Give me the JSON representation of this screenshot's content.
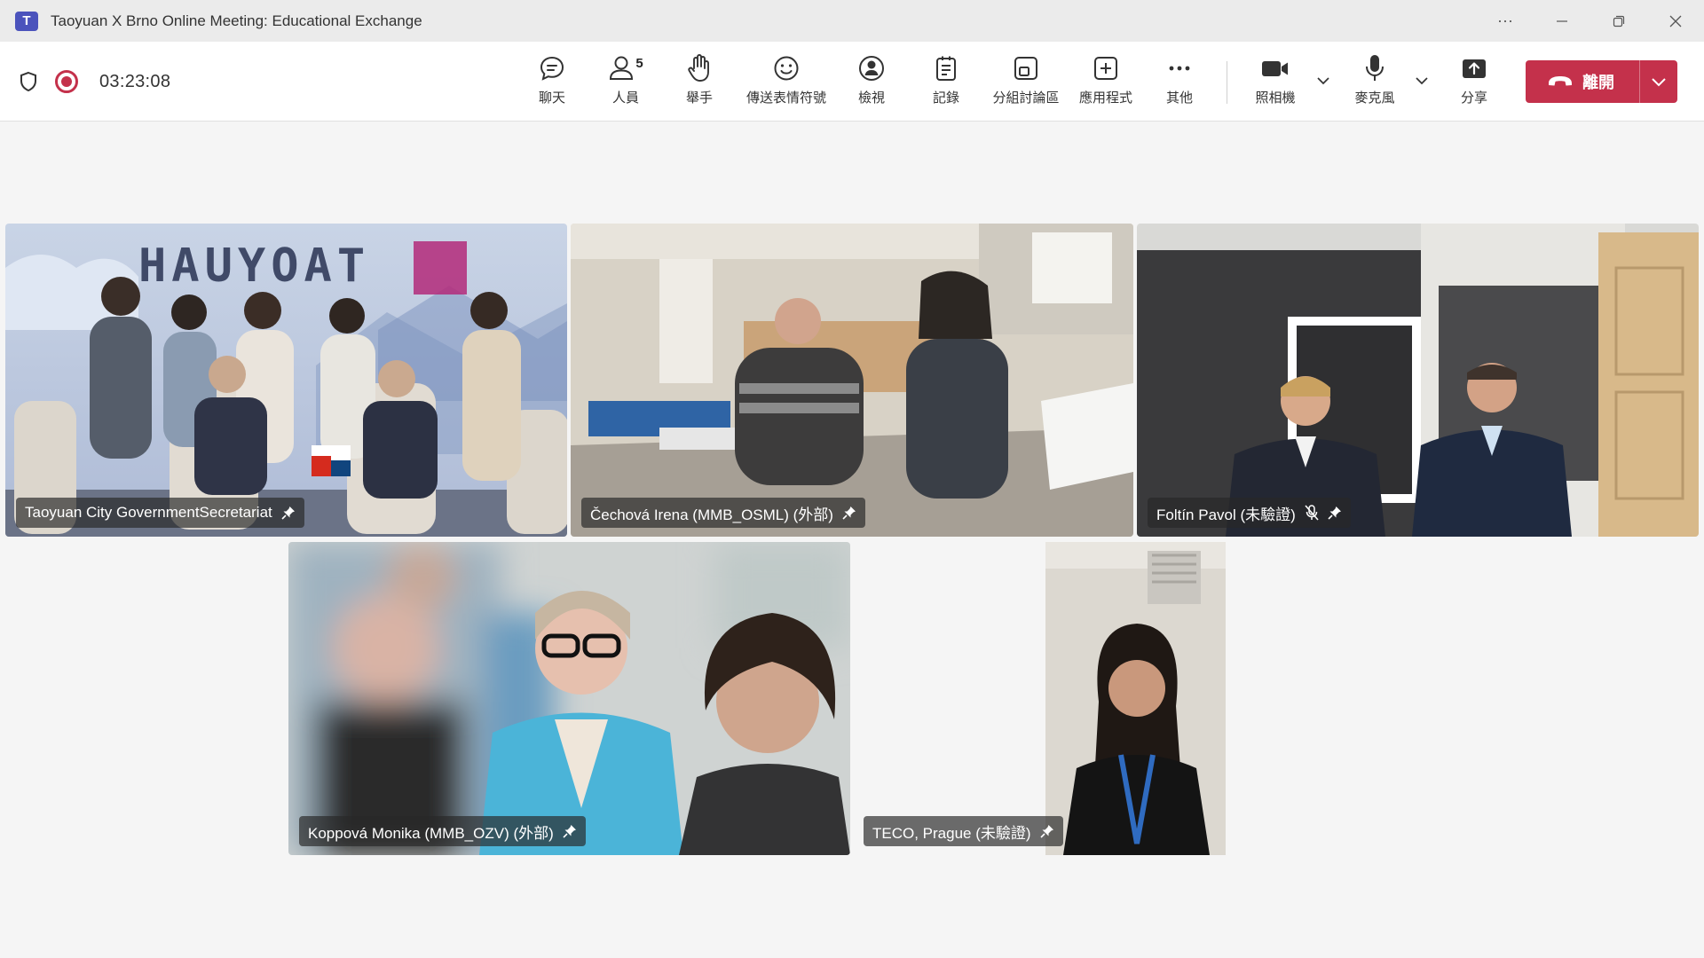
{
  "window": {
    "title": "Taoyuan X Brno Online Meeting: Educational Exchange",
    "app_icon": "teams-logo-icon",
    "more_symbol": "···"
  },
  "meeting_bar": {
    "timer": "03:23:08",
    "recording_color": "#c4314b",
    "buttons": {
      "chat": "聊天",
      "people": "人員",
      "people_count": "5",
      "raise_hand": "舉手",
      "reactions": "傳送表情符號",
      "view": "檢視",
      "notes": "記錄",
      "breakout": "分組討論區",
      "apps": "應用程式",
      "more": "其他",
      "camera": "照相機",
      "mic": "麥克風",
      "share": "分享"
    },
    "leave": {
      "label": "離開",
      "color": "#c4314b"
    }
  },
  "participants": [
    {
      "name": "Taoyuan City GovernmentSecretariat",
      "pinned": true,
      "muted": false
    },
    {
      "name": "Čechová Irena (MMB_OSML) (外部)",
      "pinned": true,
      "muted": false
    },
    {
      "name": "Foltín Pavol (未驗證)",
      "pinned": true,
      "muted": true
    },
    {
      "name": "Koppová Monika (MMB_OZV) (外部)",
      "pinned": true,
      "muted": false
    },
    {
      "name": "TECO, Prague (未驗證)",
      "pinned": true,
      "muted": false
    }
  ],
  "video_feeds": [
    {
      "wall_text": "HAUYOAT"
    }
  ]
}
